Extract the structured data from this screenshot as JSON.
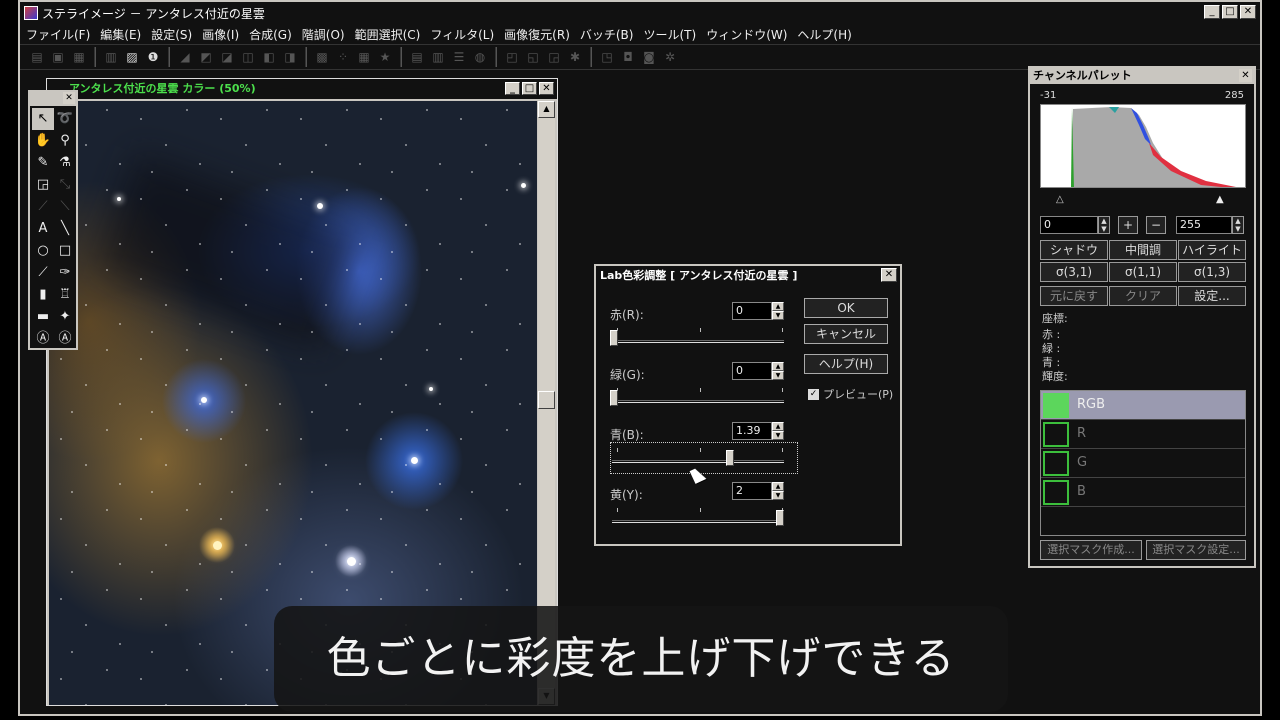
{
  "window": {
    "title": "ステライメージ － アンタレス付近の星雲"
  },
  "menu": [
    "ファイル(F)",
    "編集(E)",
    "設定(S)",
    "画像(I)",
    "合成(G)",
    "階調(O)",
    "範囲選択(C)",
    "フィルタ(L)",
    "画像復元(R)",
    "バッチ(B)",
    "ツール(T)",
    "ウィンドウ(W)",
    "ヘルプ(H)"
  ],
  "document": {
    "title": "アンタレス付近の星雲 カラー (50%)"
  },
  "dialog": {
    "title": "Lab色彩調整 [ アンタレス付近の星雲 ]",
    "rows": [
      {
        "label": "赤(R):",
        "value": "0",
        "level": 0
      },
      {
        "label": "緑(G):",
        "value": "0",
        "level": 0
      },
      {
        "label": "青(B):",
        "value": "1.39",
        "level": 0.7
      },
      {
        "label": "黄(Y):",
        "value": "2",
        "level": 1.0
      }
    ],
    "ok": "OK",
    "cancel": "キャンセル",
    "help": "ヘルプ(H)",
    "preview": "プレビュー(P)"
  },
  "channel_palette": {
    "title": "チャンネルパレット",
    "range_min": "-31",
    "range_max": "285",
    "low_value": "0",
    "high_value": "255",
    "plus": "+",
    "minus": "−",
    "tone_buttons": [
      "シャドウ",
      "中間調",
      "ハイライト"
    ],
    "sigma_buttons": [
      "σ(3,1)",
      "σ(1,1)",
      "σ(1,3)"
    ],
    "action_buttons": [
      "元に戻す",
      "クリア",
      "設定..."
    ],
    "coord_label": "座標:",
    "info_labels": [
      "赤  :",
      "緑  :",
      "青  :",
      "輝度:"
    ],
    "channels": [
      "RGB",
      "R",
      "G",
      "B"
    ],
    "mask_create": "選択マスク作成...",
    "mask_settings": "選択マスク設定..."
  },
  "caption": "色ごとに彩度を上げ下げできる",
  "colors": {
    "channel_green": "#3cbf3c",
    "title_green": "#4ce04c",
    "selected_row": "#9a9ab0"
  }
}
